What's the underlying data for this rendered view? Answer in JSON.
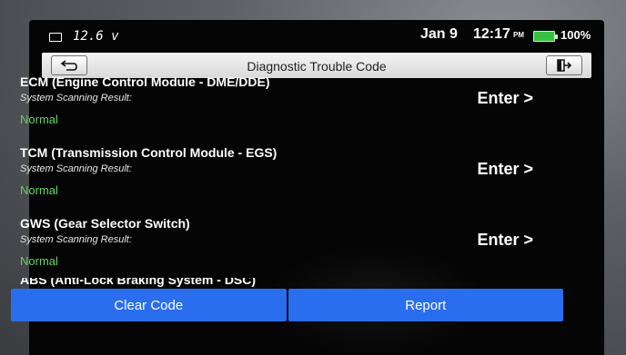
{
  "status_bar": {
    "voltage": "12.6 v",
    "date": "Jan 9",
    "time": "12:17",
    "ampm": "PM",
    "battery_percent": "100%",
    "battery_color": "#35c23f"
  },
  "header": {
    "title": "Diagnostic Trouble Code",
    "back_icon": "back-arrow-icon",
    "exit_icon": "exit-door-icon"
  },
  "modules": [
    {
      "title": "ECM (Engine Control Module - DME/DDE)",
      "subtitle": "System Scanning Result:",
      "status": "Normal",
      "action": "Enter >"
    },
    {
      "title": "TCM (Transmission Control Module - EGS)",
      "subtitle": "System Scanning Result:",
      "status": "Normal",
      "action": "Enter >"
    },
    {
      "title": "GWS (Gear Selector Switch)",
      "subtitle": "System Scanning Result:",
      "status": "Normal",
      "action": "Enter >"
    },
    {
      "title": "ABS (Anti-Lock Braking System - DSC)"
    }
  ],
  "footer": {
    "clear_label": "Clear Code",
    "report_label": "Report"
  },
  "colors": {
    "status_normal": "#62d35e",
    "button_blue": "#2a6ef0"
  }
}
